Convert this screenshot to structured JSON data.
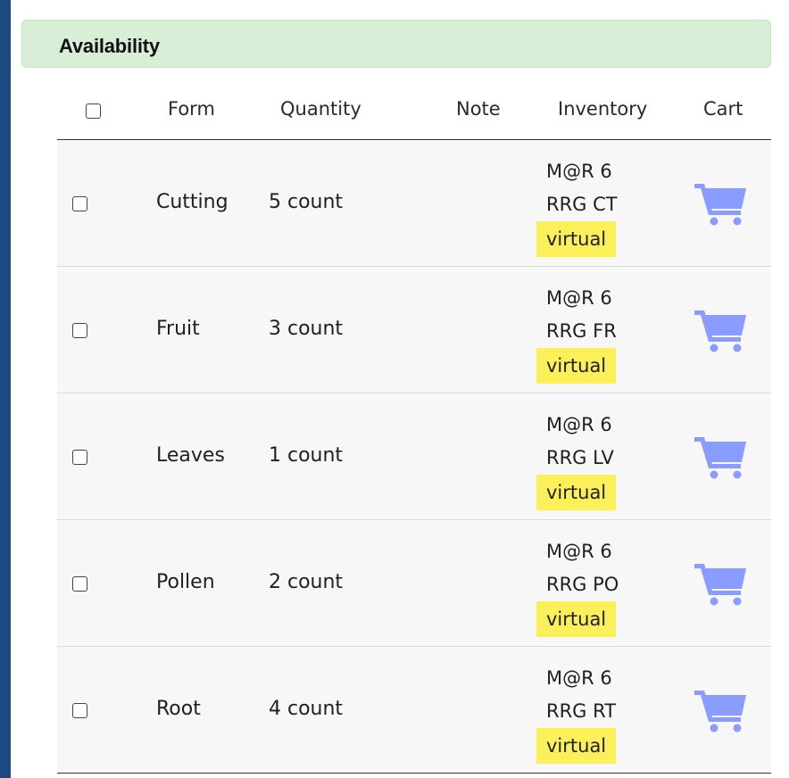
{
  "header": {
    "title": "Availability"
  },
  "table": {
    "columns": [
      "Form",
      "Quantity",
      "Note",
      "Inventory",
      "Cart"
    ],
    "rows": [
      {
        "form": "Cutting",
        "quantity": "5 count",
        "note": "",
        "inventory_line1": "M@R 6",
        "inventory_line2": "RRG CT",
        "inventory_tag": "virtual"
      },
      {
        "form": "Fruit",
        "quantity": "3 count",
        "note": "",
        "inventory_line1": "M@R 6",
        "inventory_line2": "RRG FR",
        "inventory_tag": "virtual"
      },
      {
        "form": "Leaves",
        "quantity": "1 count",
        "note": "",
        "inventory_line1": "M@R 6",
        "inventory_line2": "RRG LV",
        "inventory_tag": "virtual"
      },
      {
        "form": "Pollen",
        "quantity": "2 count",
        "note": "",
        "inventory_line1": "M@R 6",
        "inventory_line2": "RRG PO",
        "inventory_tag": "virtual"
      },
      {
        "form": "Root",
        "quantity": "4 count",
        "note": "",
        "inventory_line1": "M@R 6",
        "inventory_line2": "RRG RT",
        "inventory_tag": "virtual"
      }
    ]
  },
  "icons": {
    "select_all": "checkbox-icon",
    "row_select": "checkbox-icon",
    "cart": "shopping-cart-icon"
  },
  "colors": {
    "background": "#1d4a82",
    "header_bar": "#d8eed7",
    "virtual_highlight": "#fbf05a",
    "cart_icon": "#8a9cff"
  }
}
